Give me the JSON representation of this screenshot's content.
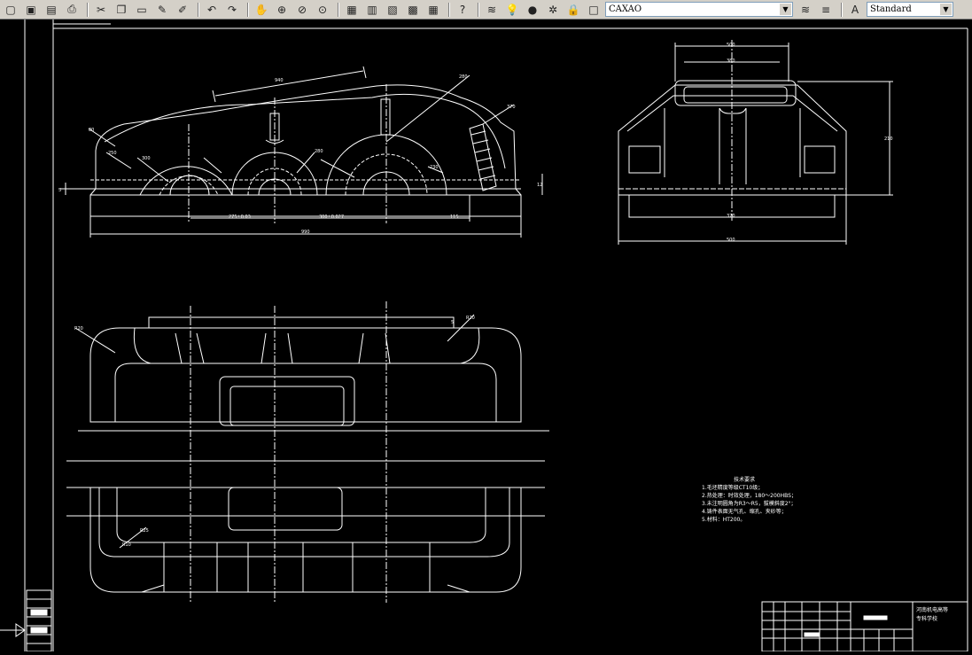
{
  "toolbar": {
    "layer_name": "CAXAO",
    "text_style": "Standard",
    "buttons": [
      "new-icon",
      "open-icon",
      "save-icon",
      "print-icon",
      "cut-icon",
      "copy-icon",
      "paste-icon",
      "brush-icon",
      "match-properties-icon",
      "undo-icon",
      "redo-icon",
      "pan-icon",
      "zoom-window-icon",
      "zoom-realtime-icon",
      "zoom-previous-icon",
      "properties-icon",
      "design-center-icon",
      "tool-palette-icon",
      "markup-icon",
      "calculator-icon",
      "help-icon"
    ]
  },
  "drawing": {
    "dims_front": [
      "180",
      "940",
      "740",
      "80",
      "370",
      "270",
      "80",
      "250",
      "300",
      "280",
      "230",
      "280",
      "370",
      "57",
      "120",
      "180",
      "190",
      "275±0.03",
      "300±0.027",
      "115",
      "990",
      "12",
      "5"
    ],
    "dims_side": [
      "500",
      "380",
      "210",
      "370",
      "500"
    ],
    "dims_plan": [
      "R20",
      "R20",
      "5",
      "R10",
      "R25"
    ],
    "tech_title": "技术要求",
    "tech_lines": [
      "1.毛坯精度等级CT10级；",
      "2.热处理：时效处理，180～200HBS；",
      "3.未注明圆角为R3～R5，拔模斜度2°；",
      "4.铸件表面无气孔、缩孔、夹砂等；",
      "5.材料：HT200。"
    ],
    "title_block": {
      "school_line1": "河南机电高等",
      "school_line2": "专科学校"
    }
  },
  "colors": {
    "toolbar_bg": "#d4d0c8",
    "canvas_bg": "#000000",
    "lines": "#ffffff",
    "lines_dim": "#e8e8e8"
  }
}
